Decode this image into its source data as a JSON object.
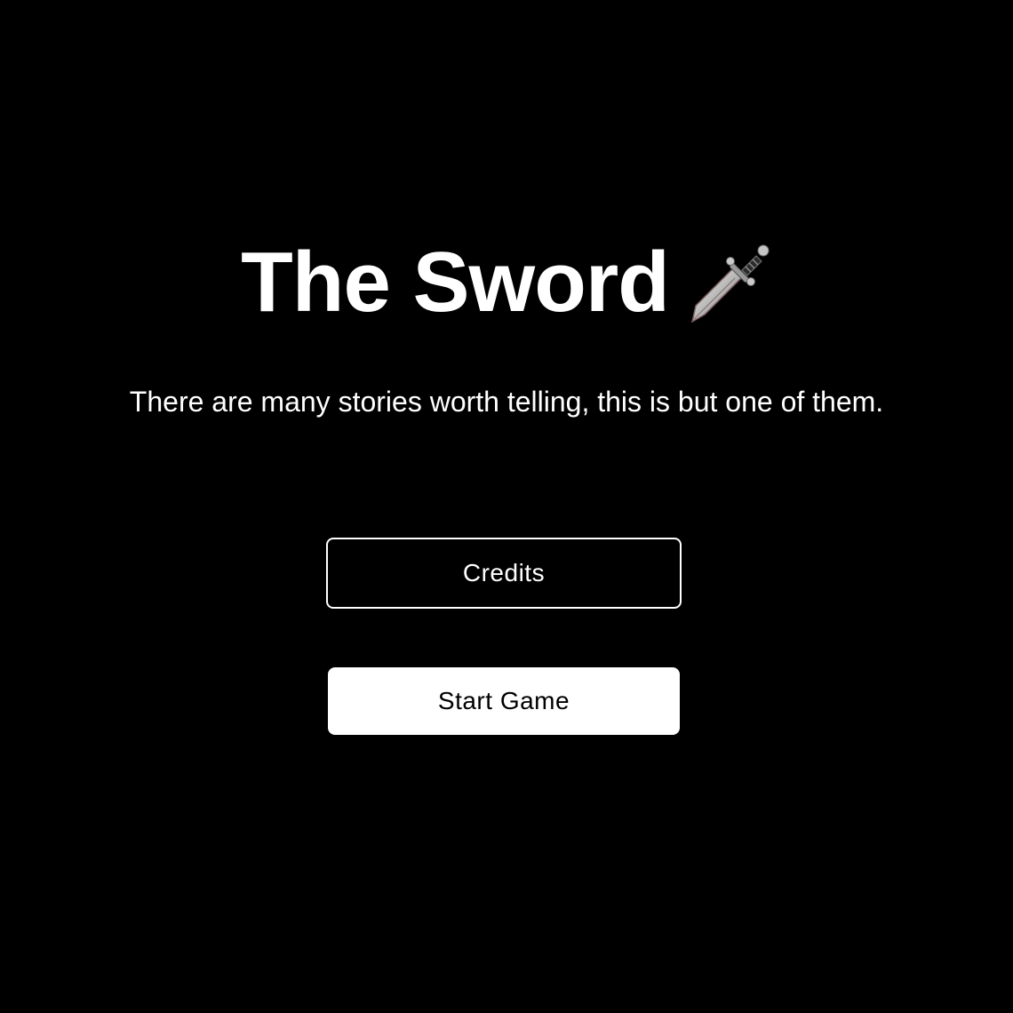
{
  "title": {
    "text": "The Sword",
    "icon": "dagger-icon"
  },
  "subtitle": "There are many stories worth telling, this is but one of them.",
  "menu": {
    "credits_label": "Credits",
    "start_label": "Start Game"
  },
  "colors": {
    "background": "#000000",
    "text": "#ffffff",
    "primary_button_bg": "#ffffff",
    "primary_button_text": "#000000"
  }
}
